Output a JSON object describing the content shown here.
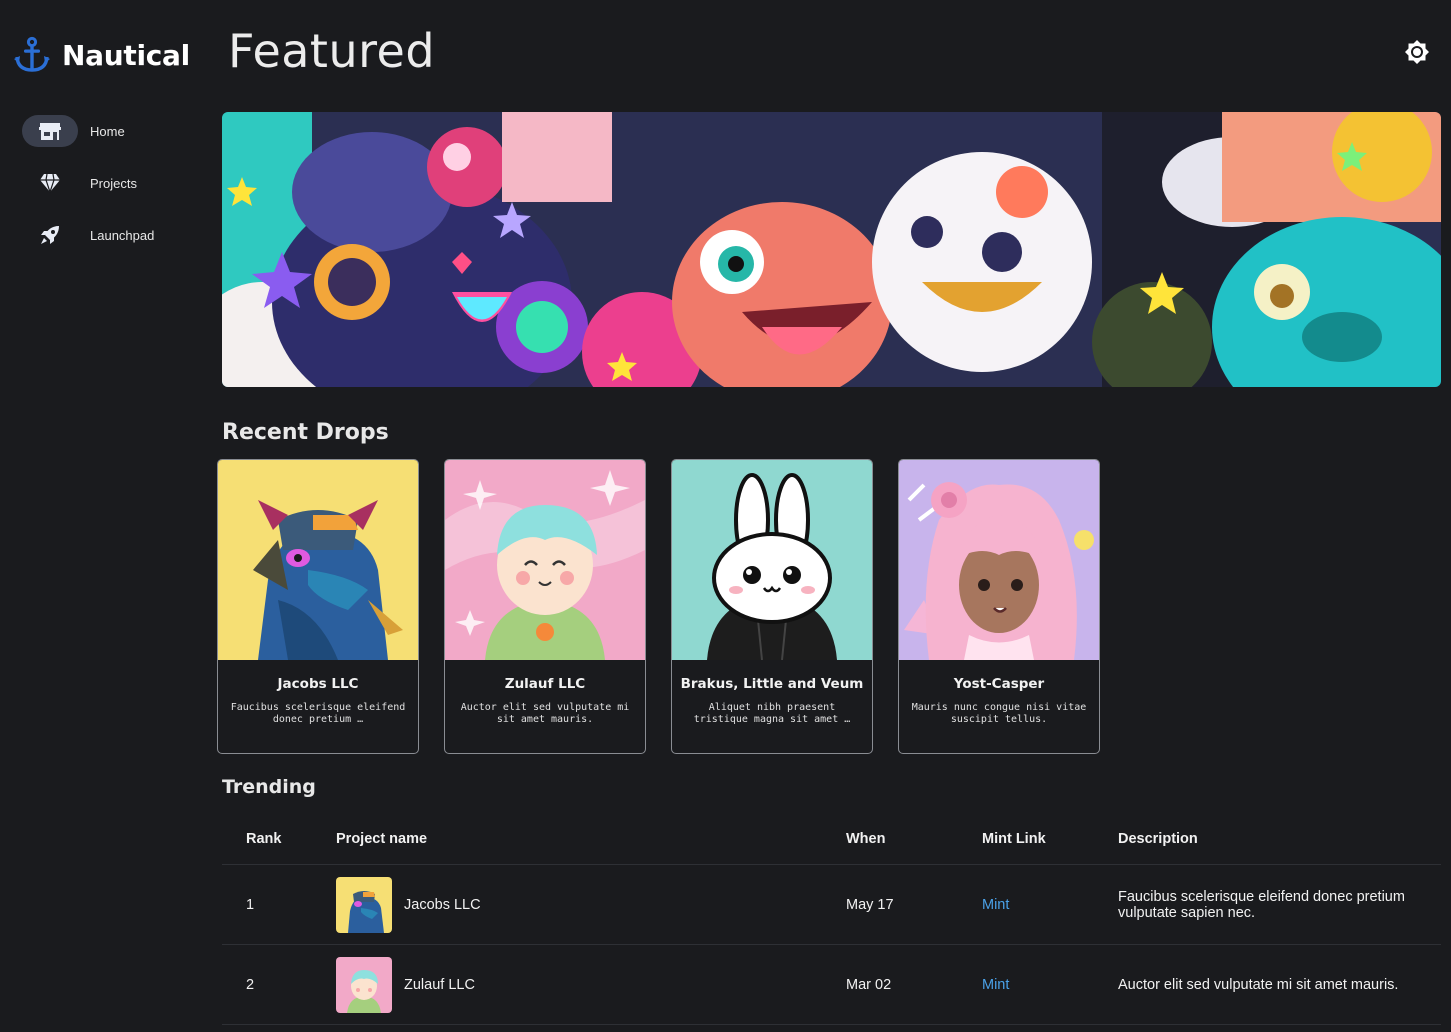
{
  "app": {
    "name": "Nautical",
    "brand_color": "#2b6fd6"
  },
  "sidebar": {
    "items": [
      {
        "label": "Home",
        "icon": "storefront-icon",
        "active": true
      },
      {
        "label": "Projects",
        "icon": "diamond-icon",
        "active": false
      },
      {
        "label": "Launchpad",
        "icon": "rocket-icon",
        "active": false
      }
    ]
  },
  "header": {
    "title": "Featured",
    "theme_toggle_icon": "brightness-icon"
  },
  "recent_drops": {
    "title": "Recent Drops",
    "cards": [
      {
        "title": "Jacobs LLC",
        "description": "Faucibus scelerisque eleifend donec pretium …",
        "bg": "#f6df74"
      },
      {
        "title": "Zulauf LLC",
        "description": "Auctor elit sed vulputate mi sit amet mauris.",
        "bg": "#f2a9c8"
      },
      {
        "title": "Brakus, Little and Veum",
        "description": "Aliquet nibh praesent tristique magna sit amet …",
        "bg": "#8fd8d0"
      },
      {
        "title": "Yost-Casper",
        "description": "Mauris nunc congue nisi vitae suscipit tellus.",
        "bg": "#c8b4ec"
      }
    ]
  },
  "trending": {
    "title": "Trending",
    "columns": [
      "Rank",
      "Project name",
      "When",
      "Mint Link",
      "Description"
    ],
    "rows": [
      {
        "rank": "1",
        "name": "Jacobs LLC",
        "when": "May 17",
        "mint": "Mint",
        "description": "Faucibus scelerisque eleifend donec pretium vulputate sapien nec."
      },
      {
        "rank": "2",
        "name": "Zulauf LLC",
        "when": "Mar 02",
        "mint": "Mint",
        "description": "Auctor elit sed vulputate mi sit amet mauris."
      }
    ]
  },
  "colors": {
    "background": "#1a1b1e",
    "link": "#4aa0e6",
    "active_nav": "#3a3f4d"
  }
}
